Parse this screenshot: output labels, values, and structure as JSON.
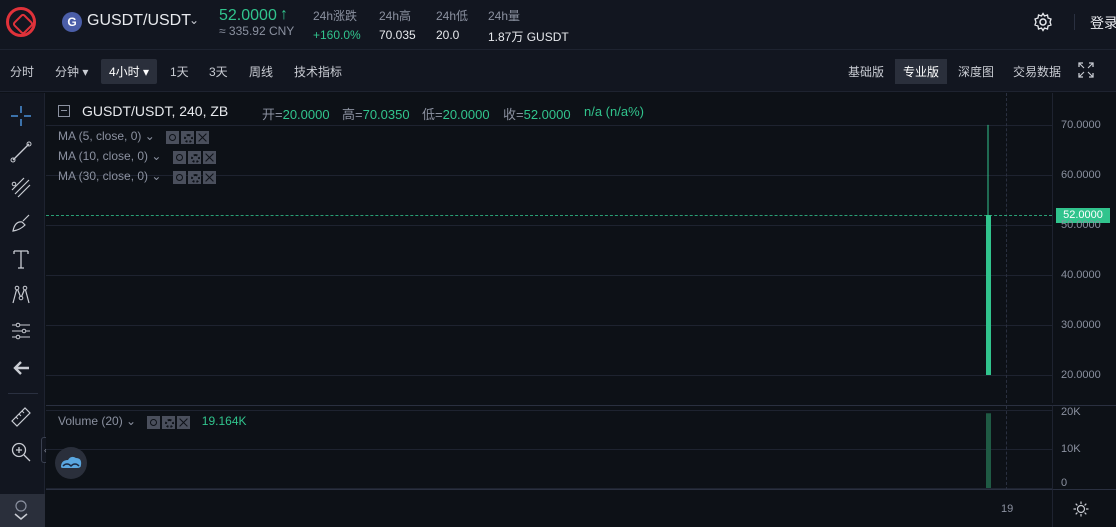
{
  "header": {
    "pair_coin_letter": "G",
    "pair_name": "GUSDT/USDT",
    "pair_caret": "⌄",
    "last_price": "52.0000",
    "price_arrow": "↑",
    "cny_price": "≈ 335.92 CNY",
    "stats": [
      {
        "label": "24h涨跌",
        "value": "+160.0%",
        "up": true
      },
      {
        "label": "24h高",
        "value": "70.035",
        "up": false
      },
      {
        "label": "24h低",
        "value": "20.0",
        "up": false
      },
      {
        "label": "24h量",
        "value": "1.87万 GUSDT",
        "up": false
      }
    ],
    "login_label": "登录"
  },
  "toolbar": {
    "intervals": [
      "分时",
      "分钟",
      "4小时",
      "1天",
      "3天",
      "周线",
      "技术指标"
    ],
    "active_interval": "4小时",
    "caret": "▾",
    "views": [
      "基础版",
      "专业版",
      "深度图",
      "交易数据"
    ],
    "active_view": "专业版"
  },
  "chart": {
    "title": "GUSDT/USDT, 240, ZB",
    "ohlc": [
      {
        "k": "开=",
        "v": "20.0000"
      },
      {
        "k": "高=",
        "v": "70.0350"
      },
      {
        "k": "低=",
        "v": "20.0000"
      },
      {
        "k": "收=",
        "v": "52.0000"
      },
      {
        "k": "",
        "v": "n/a (n/a%)"
      }
    ],
    "indicators": [
      "MA (5, close, 0)",
      "MA (10, close, 0)",
      "MA (30, close, 0)"
    ],
    "indicator_caret": "⌄",
    "price_axis": [
      "70.0000",
      "60.0000",
      "50.0000",
      "40.0000",
      "30.0000",
      "20.0000"
    ],
    "current_price_tag": "52.0000",
    "volume_label": "Volume (20)",
    "volume_value": "19.164K",
    "volume_axis": [
      "20K",
      "10K",
      "0"
    ],
    "time_label": "19",
    "colors": {
      "up": "#31c48d",
      "bg": "#0d1117",
      "grid": "#1e2330"
    }
  },
  "chart_data": {
    "type": "bar",
    "categories": [
      "19"
    ],
    "series": [
      {
        "name": "",
        "values": [
          52.0
        ]
      }
    ],
    "candle": {
      "open": 20.0,
      "high": 70.035,
      "low": 20.0,
      "close": 52.0
    },
    "volume": 19164,
    "ylim": [
      20,
      70
    ],
    "volume_ylim": [
      0,
      20000
    ],
    "grid": true
  }
}
